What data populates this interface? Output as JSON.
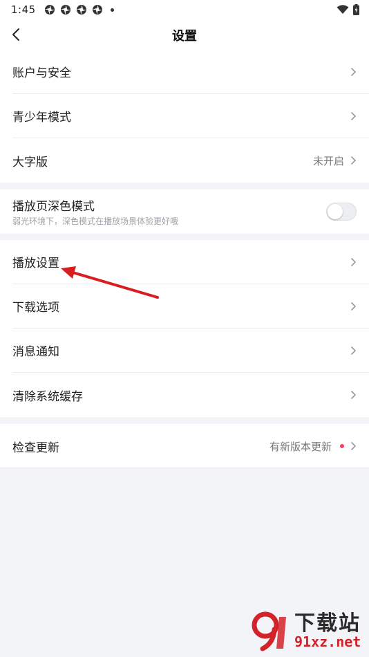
{
  "status_bar": {
    "time": "1:45"
  },
  "nav": {
    "title": "设置"
  },
  "groups": [
    {
      "items": [
        {
          "label": "账户与安全",
          "value": ""
        },
        {
          "label": "青少年模式",
          "value": ""
        },
        {
          "label": "大字版",
          "value": "未开启"
        }
      ]
    },
    {
      "items": [
        {
          "label": "播放页深色模式",
          "subtitle": "弱光环境下，深色模式在播放场景体验更好哦",
          "toggle": false
        }
      ]
    },
    {
      "items": [
        {
          "label": "播放设置"
        },
        {
          "label": "下载选项"
        },
        {
          "label": "消息通知"
        },
        {
          "label": "清除系统缓存"
        }
      ]
    },
    {
      "items": [
        {
          "label": "检查更新",
          "value": "有新版本更新",
          "badge": "red-dot"
        }
      ]
    }
  ],
  "watermark": {
    "title": "下载站",
    "url": "91xz.net"
  },
  "colors": {
    "background": "#f3f4f8",
    "badge_red": "#ff3b5c",
    "annotation_arrow": "#d81e1e",
    "watermark_red": "#d2232a"
  }
}
